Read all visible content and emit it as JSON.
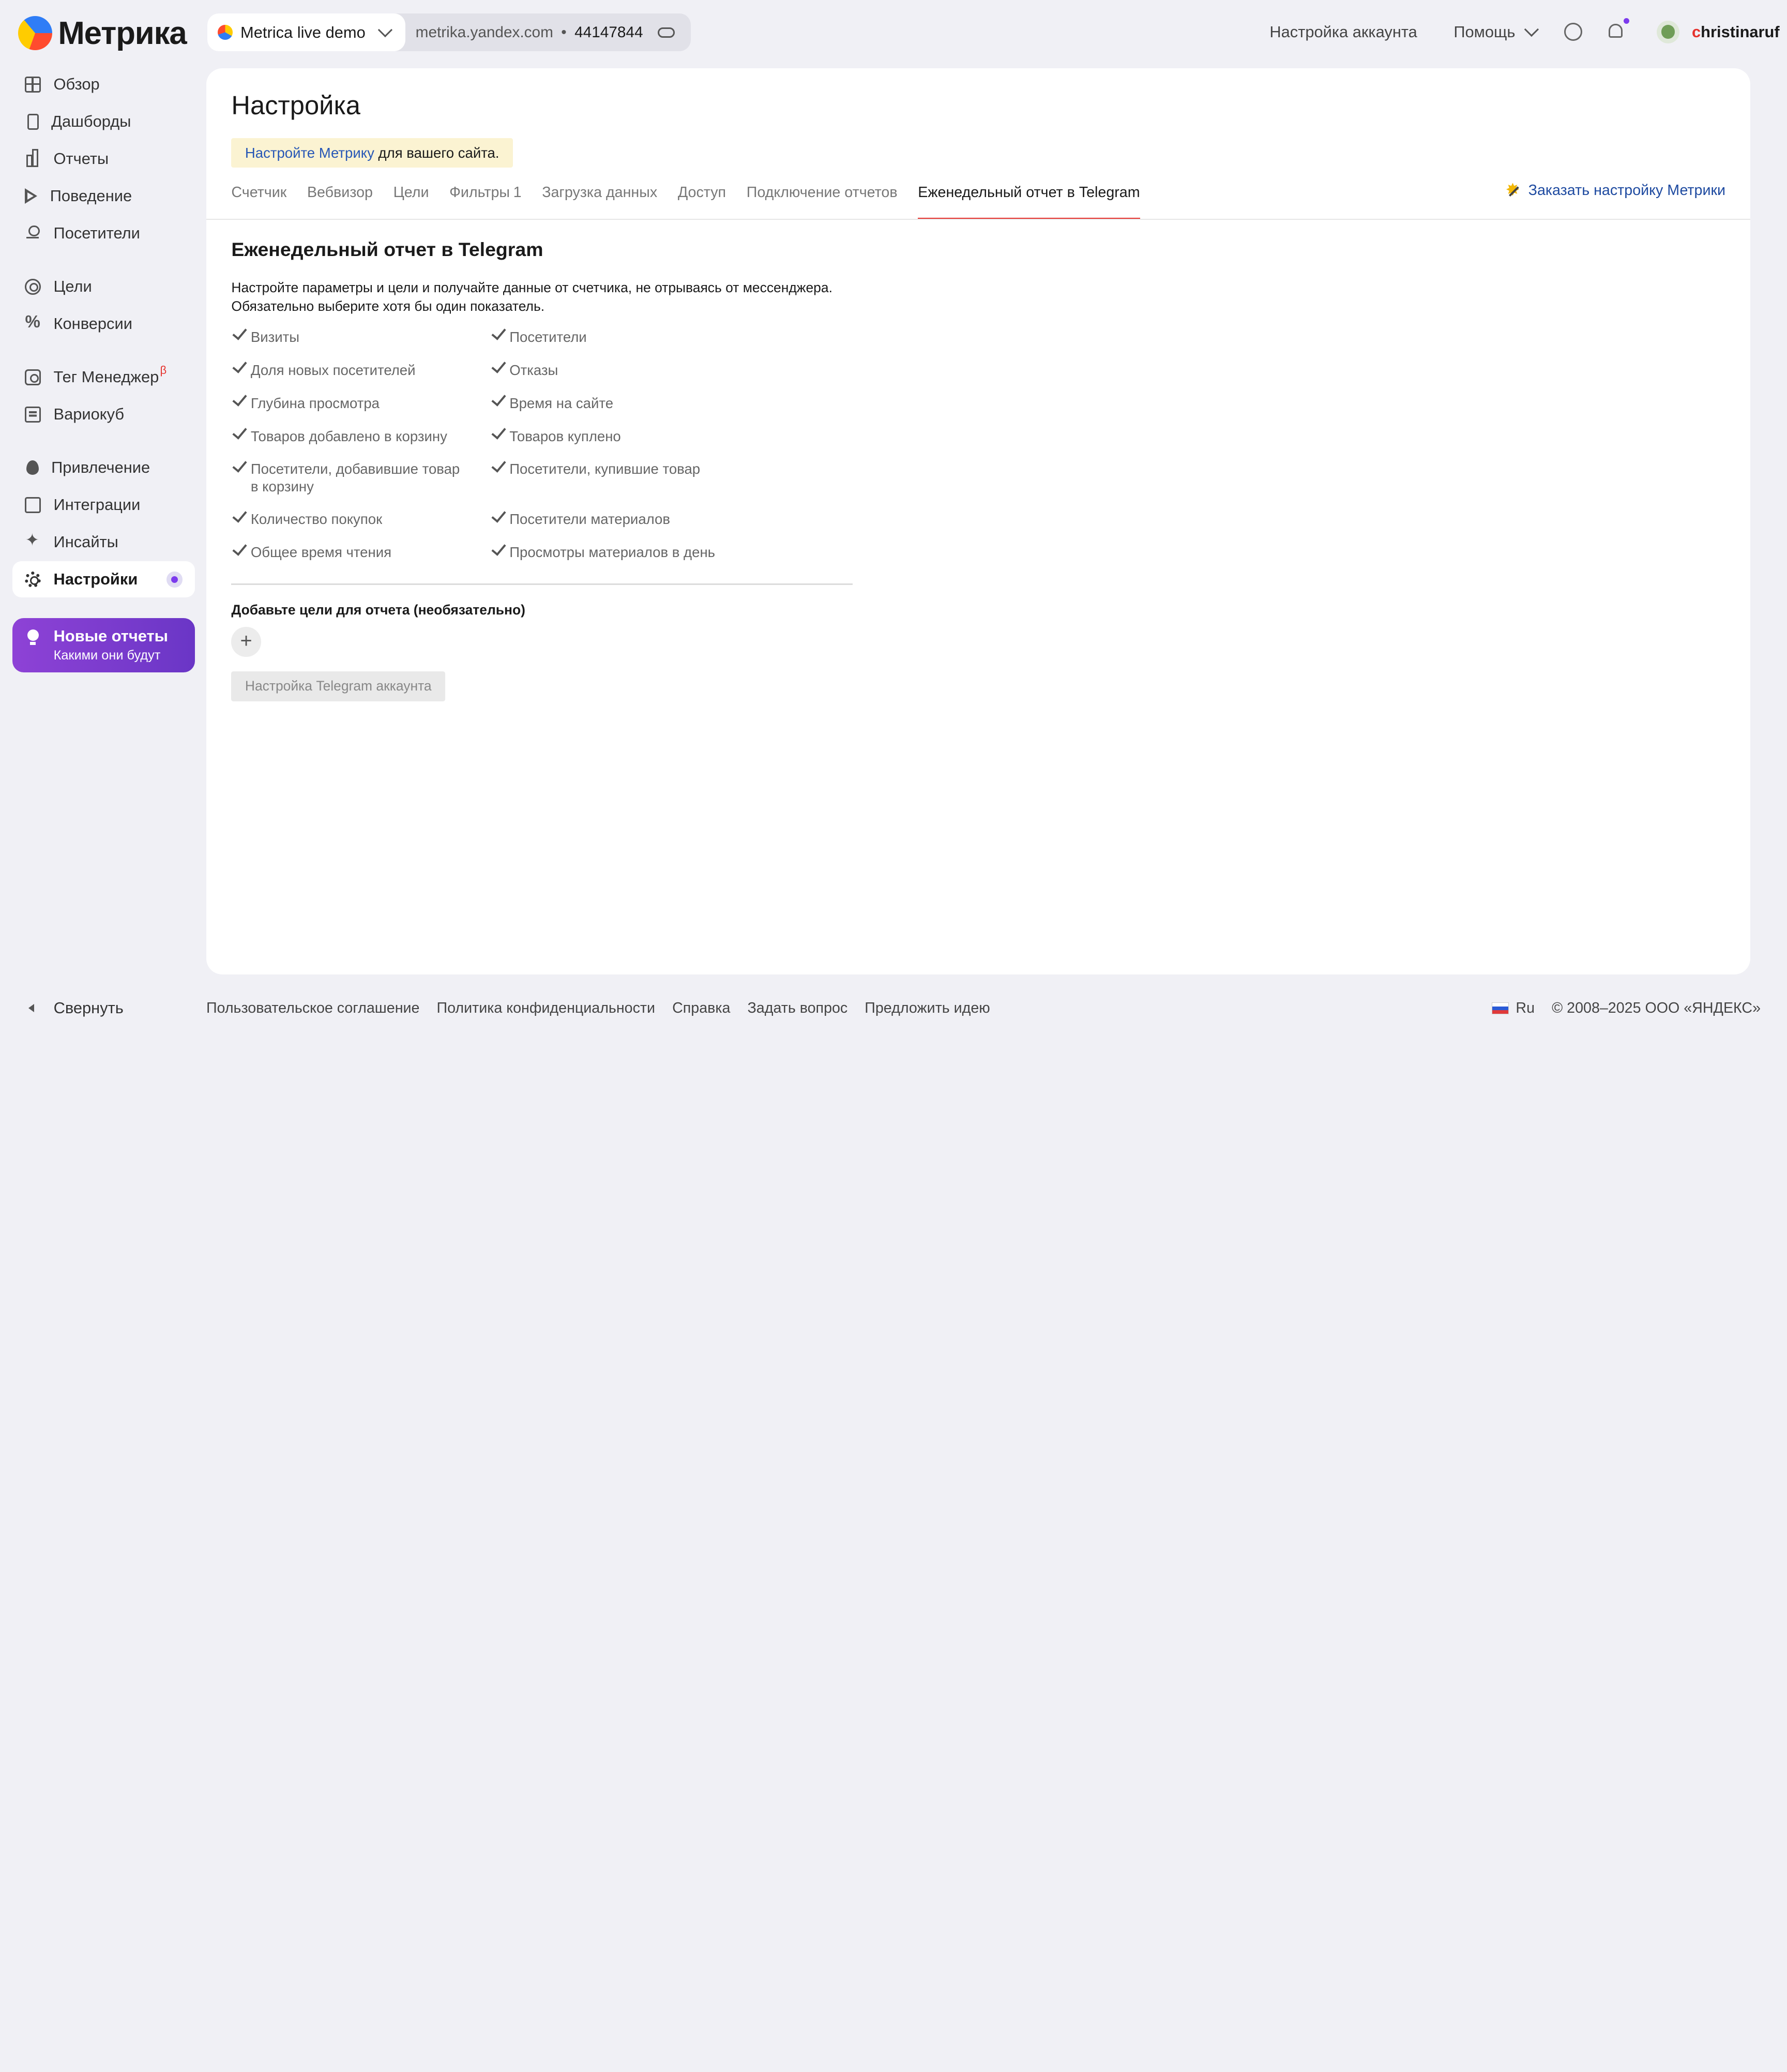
{
  "header": {
    "logo_text": "Метрика",
    "counter_name": "Metrica live demo",
    "counter_domain": "metrika.yandex.com",
    "counter_sep": "•",
    "counter_id": "44147844",
    "account_settings": "Настройка аккаунта",
    "help": "Помощь",
    "user_first": "c",
    "user_rest": "hristinaruf"
  },
  "sidebar": {
    "items": [
      {
        "label": "Обзор",
        "icon": "grid-icon"
      },
      {
        "label": "Дашборды",
        "icon": "dashboard-icon"
      },
      {
        "label": "Отчеты",
        "icon": "bar-chart-icon"
      },
      {
        "label": "Поведение",
        "icon": "play-icon"
      },
      {
        "label": "Посетители",
        "icon": "person-icon"
      },
      {
        "label": "Цели",
        "icon": "target-icon"
      },
      {
        "label": "Конверсии",
        "icon": "percent-icon"
      },
      {
        "label": "Тег Менеджер",
        "icon": "tag-icon",
        "badge": "β"
      },
      {
        "label": "Вариокуб",
        "icon": "cube-icon"
      },
      {
        "label": "Привлечение",
        "icon": "fire-icon"
      },
      {
        "label": "Интеграции",
        "icon": "puzzle-icon"
      },
      {
        "label": "Инсайты",
        "icon": "sparkle-icon"
      },
      {
        "label": "Настройки",
        "icon": "gear-icon"
      }
    ],
    "promo_title": "Новые отчеты",
    "promo_subtitle": "Какими они будут",
    "collapse": "Свернуть"
  },
  "main": {
    "title": "Настройка",
    "notice_link": "Настройте Метрику",
    "notice_rest": " для вашего сайта.",
    "tabs": [
      {
        "label": "Счетчик"
      },
      {
        "label": "Вебвизор"
      },
      {
        "label": "Цели"
      },
      {
        "label": "Фильтры",
        "count": "1"
      },
      {
        "label": "Загрузка данных"
      },
      {
        "label": "Доступ"
      },
      {
        "label": "Подключение отчетов"
      },
      {
        "label": "Еженедельный отчет в Telegram"
      }
    ],
    "active_tab": "Еженедельный отчет в Telegram",
    "order_link": "Заказать настройку Метрики",
    "section_title": "Еженедельный отчет в Telegram",
    "desc_line1": "Настройте параметры и цели и получайте данные от счетчика, не отрываясь от мессенджера.",
    "desc_line2": "Обязательно выберите хотя бы один показатель.",
    "checkboxes_left": [
      {
        "label": "Визиты",
        "checked": true
      },
      {
        "label": "Доля новых посетителей",
        "checked": true
      },
      {
        "label": "Глубина просмотра",
        "checked": true
      },
      {
        "label": "Товаров добавлено в корзину",
        "checked": true
      },
      {
        "label": "Посетители, добавившие товар в корзину",
        "checked": true
      },
      {
        "label": "Количество покупок",
        "checked": true
      },
      {
        "label": "Общее время чтения",
        "checked": true
      }
    ],
    "checkboxes_right": [
      {
        "label": "Посетители",
        "checked": true
      },
      {
        "label": "Отказы",
        "checked": true
      },
      {
        "label": "Время на сайте",
        "checked": true
      },
      {
        "label": "Товаров куплено",
        "checked": true
      },
      {
        "label": "Посетители, купившие товар",
        "checked": true
      },
      {
        "label": "Посетители материалов",
        "checked": true
      },
      {
        "label": "Просмотры материалов в день",
        "checked": true
      }
    ],
    "goals_title": "Добавьте цели для отчета (необязательно)",
    "add_symbol": "+",
    "telegram_button": "Настройка Telegram аккаунта"
  },
  "footer": {
    "links": [
      "Пользовательское соглашение",
      "Политика конфиденциальности",
      "Справка",
      "Задать вопрос",
      "Предложить идею"
    ],
    "lang": "Ru",
    "copyright": "© 2008–2025 ООО «ЯНДЕКС»"
  },
  "colors": {
    "accent": "#7c3aed",
    "tab_active": "#e5322d",
    "link": "#2757b6"
  }
}
